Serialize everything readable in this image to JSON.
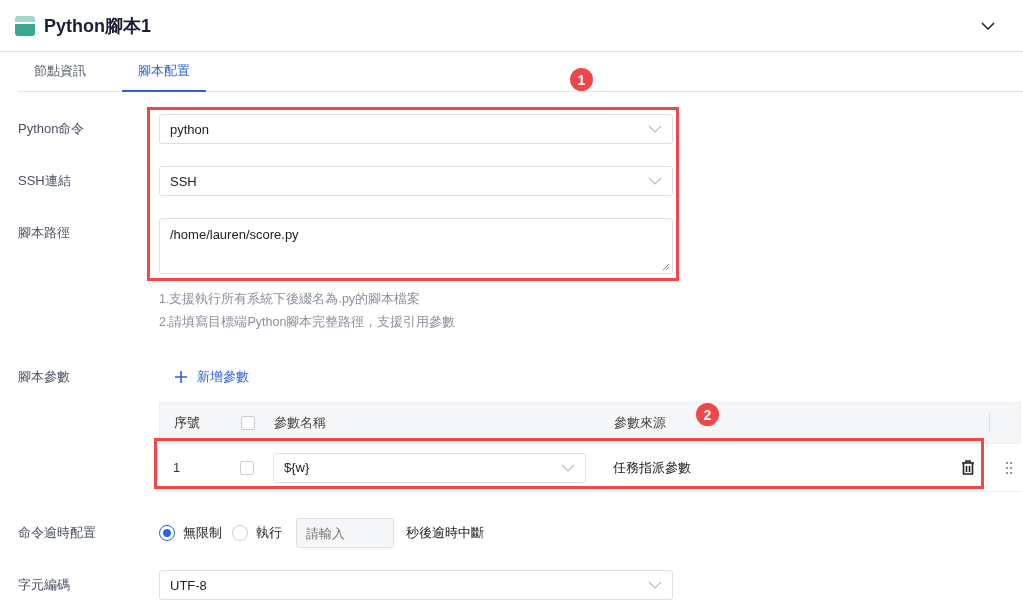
{
  "header": {
    "title": "Python腳本1",
    "expanded": true
  },
  "tabs": [
    {
      "label": "節點資訊",
      "selected": false
    },
    {
      "label": "腳本配置",
      "selected": true
    }
  ],
  "form": {
    "python_command": {
      "label": "Python命令",
      "value": "python"
    },
    "ssh": {
      "label": "SSH連結",
      "value": "SSH"
    },
    "script_path": {
      "label": "腳本路徑",
      "value": "/home/lauren/score.py"
    },
    "hints": [
      "1.支援執行所有系統下後綴名為.py的腳本檔案",
      "2.請填寫目標端Python腳本完整路徑，支援引用參數"
    ],
    "params": {
      "label": "腳本參數",
      "add_label": "新增參數",
      "columns": [
        "序號",
        "參數名稱",
        "參數來源"
      ],
      "header_checked": false,
      "rows": [
        {
          "index": "1",
          "checked": false,
          "name": "${w}",
          "source": "任務指派參數"
        }
      ]
    },
    "timeout": {
      "label": "命令逾時配置",
      "options": [
        {
          "label": "無限制",
          "selected": true
        },
        {
          "label": "執行",
          "selected": false
        }
      ],
      "placeholder": "請輸入",
      "suffix": "秒後逾時中斷"
    },
    "encoding": {
      "label": "字元編碼",
      "value": "UTF-8"
    }
  },
  "annotations": [
    {
      "number": "1"
    },
    {
      "number": "2"
    }
  ]
}
